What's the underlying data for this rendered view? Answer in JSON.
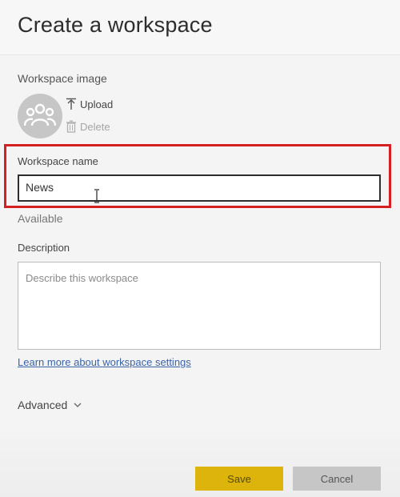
{
  "dialog": {
    "title": "Create a workspace"
  },
  "workspace_image": {
    "label": "Workspace image",
    "avatar_icon": "people-group-icon",
    "upload_label": "Upload",
    "upload_icon": "upload-arrow-icon",
    "delete_label": "Delete",
    "delete_icon": "trash-icon"
  },
  "workspace_name": {
    "label": "Workspace name",
    "value": "News",
    "status": "Available"
  },
  "description": {
    "label": "Description",
    "placeholder": "Describe this workspace"
  },
  "links": {
    "learn_more": "Learn more about workspace settings"
  },
  "advanced": {
    "label": "Advanced",
    "icon": "chevron-down-icon"
  },
  "footer": {
    "save_label": "Save",
    "cancel_label": "Cancel"
  },
  "colors": {
    "highlight": "#d42020",
    "save_button": "#dcb40b",
    "cancel_button": "#c6c6c6",
    "link": "#3a63a8"
  }
}
